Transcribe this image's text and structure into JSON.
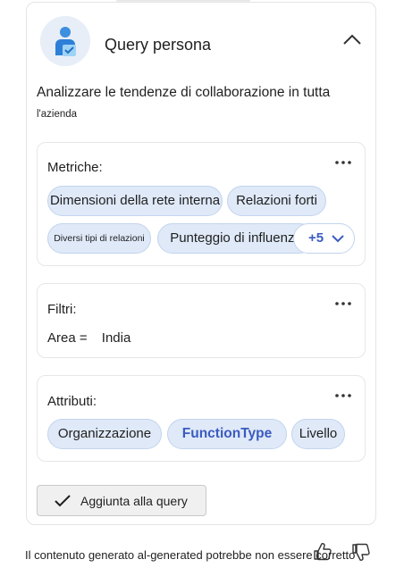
{
  "header": {
    "title": "Query persona",
    "avatar_icon": "person-badge-icon",
    "collapse_icon": "chevron-up-icon"
  },
  "description": {
    "line1": "Analizzare le tendenze di collaborazione in tutta",
    "line2": "l'azienda"
  },
  "metrics": {
    "label": "Metriche:",
    "chips": [
      "Dimensioni della rete interna",
      "Relazioni forti",
      "Diversi tipi di relazioni",
      "Punteggio di influenza"
    ],
    "more_count": "+5",
    "more_icon": "chevron-down-icon"
  },
  "filters": {
    "label": "Filtri:",
    "key": "Area =",
    "value": "India"
  },
  "attributes": {
    "label": "Attributi:",
    "chips": [
      "Organizzazione",
      "FunctionType",
      "Livello"
    ]
  },
  "add_button": {
    "label": "Aggiunta alla query",
    "icon": "checkmark-icon"
  },
  "footer": {
    "disclaimer": "Il contenuto generato al-generated potrebbe non essere corretto",
    "like_icon": "thumbs-up-icon",
    "dislike_icon": "thumbs-down-icon"
  },
  "colors": {
    "chip_background": "#dfe9f8",
    "chip_border": "#c2d4ee",
    "accent": "#3b5bbf"
  }
}
